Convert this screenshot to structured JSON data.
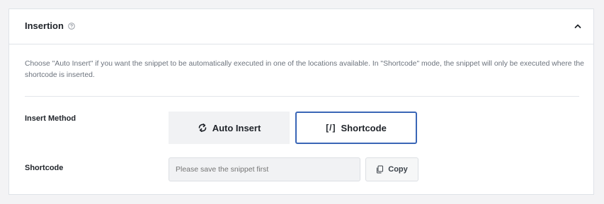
{
  "panel": {
    "title": "Insertion",
    "help_icon": "question-circle-icon",
    "collapse_icon": "chevron-up-icon",
    "description": "Choose \"Auto Insert\" if you want the snippet to be automatically executed in one of the locations available. In \"Shortcode\" mode, the snippet will only be executed where the shortcode is inserted."
  },
  "insert_method": {
    "label": "Insert Method",
    "selected": "Shortcode",
    "options": [
      {
        "label": "Auto Insert",
        "icon": "refresh-icon"
      },
      {
        "label": "Shortcode",
        "glyph": "[/]",
        "icon": "shortcode-icon"
      }
    ]
  },
  "shortcode": {
    "label": "Shortcode",
    "placeholder": "Please save the snippet first",
    "copy_label": "Copy",
    "copy_icon": "copy-icon"
  },
  "colors": {
    "accent": "#3a66b6",
    "background": "#f3f3f5"
  }
}
